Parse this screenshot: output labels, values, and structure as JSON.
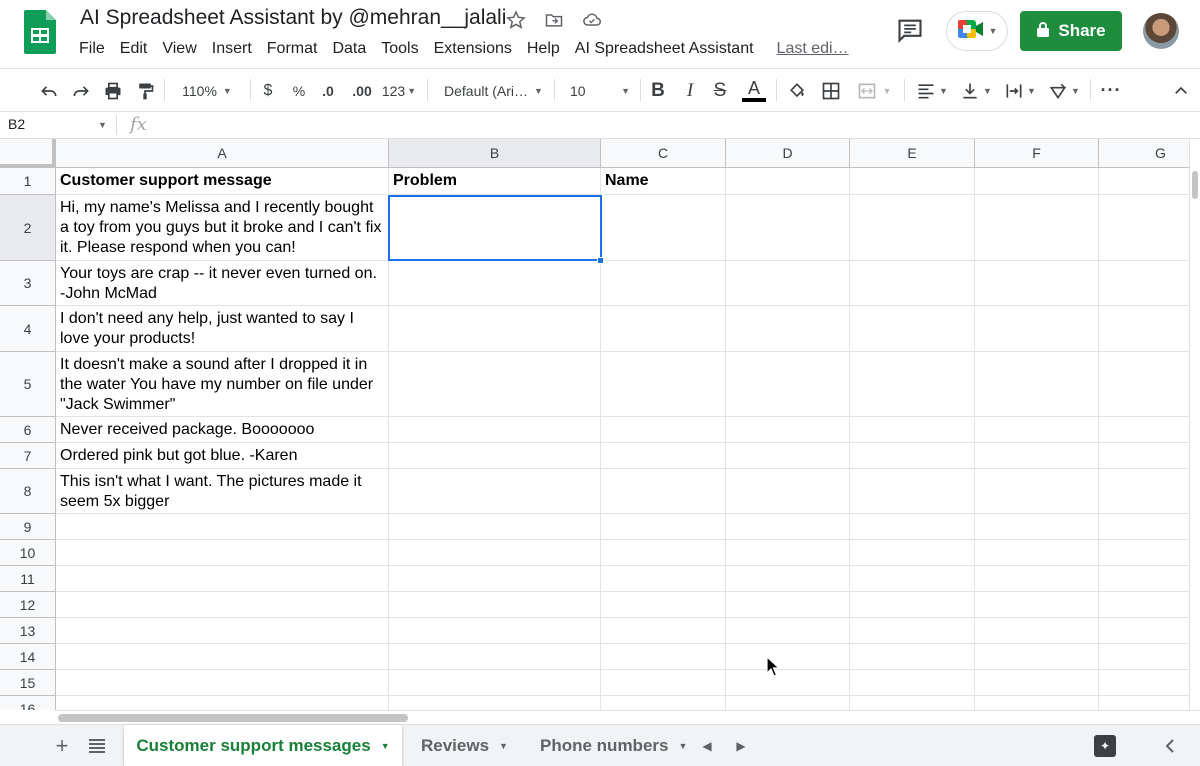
{
  "window": {
    "title": "AI Spreadsheet Assistant by @mehran__jalali",
    "last_edit": "Last edi…",
    "share_label": "Share"
  },
  "menu": [
    "File",
    "Edit",
    "View",
    "Insert",
    "Format",
    "Data",
    "Tools",
    "Extensions",
    "Help",
    "AI Spreadsheet Assistant"
  ],
  "toolbar": {
    "zoom": "110%",
    "currency": "$",
    "percent": "%",
    "decrease_decimals": ".0",
    "increase_decimals": ".00",
    "number_format": "123",
    "font_family": "Default (Ari…",
    "font_size": "10",
    "text_color": "#000000"
  },
  "formula_bar": {
    "cell_ref": "B2",
    "fx": "fx",
    "value": ""
  },
  "grid": {
    "columns": [
      "A",
      "B",
      "C",
      "D",
      "E",
      "F",
      "G"
    ],
    "rows": [
      "1",
      "2",
      "3",
      "4",
      "5",
      "6",
      "7",
      "8",
      "9",
      "10",
      "11",
      "12",
      "13",
      "14",
      "15",
      "16"
    ],
    "selected_cell": "B2",
    "cells": {
      "a1": "Customer support message",
      "b1": "Problem",
      "c1": "Name",
      "a2": "Hi, my name's Melissa and I recently bought a toy from you guys but it broke and I can't fix it.  Please respond when you can!",
      "a3": "Your toys are crap -- it never even turned on.  -John McMad",
      "a4": "I don't need any help, just wanted to say I love your products!",
      "a5": "It doesn't make a sound after I dropped it in the water  You have my number on file under \"Jack Swimmer\"",
      "a6": "Never received package.  Booooooo",
      "a7": "Ordered pink but got blue. -Karen",
      "a8": "This isn't what I want.  The pictures made it seem 5x bigger"
    }
  },
  "sheets": {
    "active": "Customer support messages",
    "others": [
      "Reviews",
      "Phone numbers"
    ]
  },
  "colors": {
    "brand_green": "#1e8e3e",
    "active_tab_text": "#188038",
    "selection": "#1a73e8"
  }
}
